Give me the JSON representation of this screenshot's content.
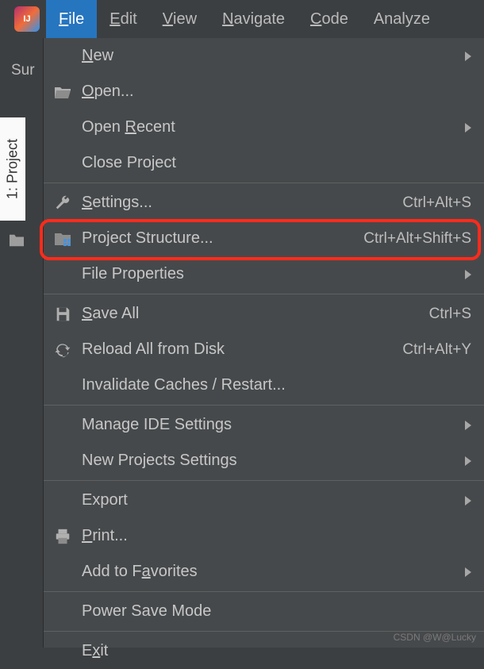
{
  "app": {
    "logo_text": "IJ"
  },
  "menubar": [
    {
      "label": "File",
      "underline": "F",
      "rest": "ile",
      "active": true
    },
    {
      "label": "Edit",
      "underline": "E",
      "rest": "dit"
    },
    {
      "label": "View",
      "underline": "V",
      "rest": "iew"
    },
    {
      "label": "Navigate",
      "underline": "N",
      "rest": "avigate"
    },
    {
      "label": "Code",
      "underline": "C",
      "rest": "ode"
    },
    {
      "label": "Analyze",
      "rest": "Analyze"
    }
  ],
  "sidebar": {
    "truncated_label": "Sur",
    "vertical_tab": "1: Project"
  },
  "file_menu": {
    "groups": [
      [
        {
          "id": "new",
          "label": "New",
          "underline": "N",
          "rest": "ew",
          "submenu": true
        },
        {
          "id": "open",
          "label": "Open...",
          "underline": "O",
          "rest": "pen...",
          "icon": "folder-open"
        },
        {
          "id": "open-recent",
          "label": "Open Recent",
          "pre": "Open ",
          "underline": "R",
          "post": "ecent",
          "submenu": true
        },
        {
          "id": "close-project",
          "label": "Close Project",
          "pre": "Close Pro",
          "underline": "j",
          "post": "ect"
        }
      ],
      [
        {
          "id": "settings",
          "label": "Settings...",
          "underline": "S",
          "rest": "ettings...",
          "icon": "wrench",
          "shortcut": "Ctrl+Alt+S"
        },
        {
          "id": "project-structure",
          "label": "Project Structure...",
          "pre": "Project Structure...",
          "icon": "project-structure",
          "shortcut": "Ctrl+Alt+Shift+S",
          "highlighted": true
        },
        {
          "id": "file-properties",
          "label": "File Properties",
          "pre": "File Properties",
          "submenu": true
        }
      ],
      [
        {
          "id": "save-all",
          "label": "Save All",
          "underline": "S",
          "rest": "ave All",
          "icon": "save",
          "shortcut": "Ctrl+S"
        },
        {
          "id": "reload",
          "label": "Reload All from Disk",
          "pre": "Reload All from Disk",
          "icon": "reload",
          "shortcut": "Ctrl+Alt+Y"
        },
        {
          "id": "invalidate",
          "label": "Invalidate Caches / Restart...",
          "pre": "Invalidate Caches / Restart..."
        }
      ],
      [
        {
          "id": "manage-ide",
          "label": "Manage IDE Settings",
          "pre": "Manage IDE Settings",
          "submenu": true
        },
        {
          "id": "new-projects-settings",
          "label": "New Projects Settings",
          "pre": "New Projects Settings",
          "submenu": true
        }
      ],
      [
        {
          "id": "export",
          "label": "Export",
          "pre": "Export",
          "submenu": true
        },
        {
          "id": "print",
          "label": "Print...",
          "underline": "P",
          "rest": "rint...",
          "icon": "print"
        },
        {
          "id": "add-favorites",
          "label": "Add to Favorites",
          "pre": "Add to F",
          "underline": "a",
          "post": "vorites",
          "submenu": true
        }
      ],
      [
        {
          "id": "power-save",
          "label": "Power Save Mode",
          "pre": "Power Save Mode"
        }
      ],
      [
        {
          "id": "exit",
          "label": "Exit",
          "pre": "E",
          "underline": "x",
          "post": "it"
        }
      ]
    ]
  },
  "watermark": "CSDN @W@Lucky"
}
